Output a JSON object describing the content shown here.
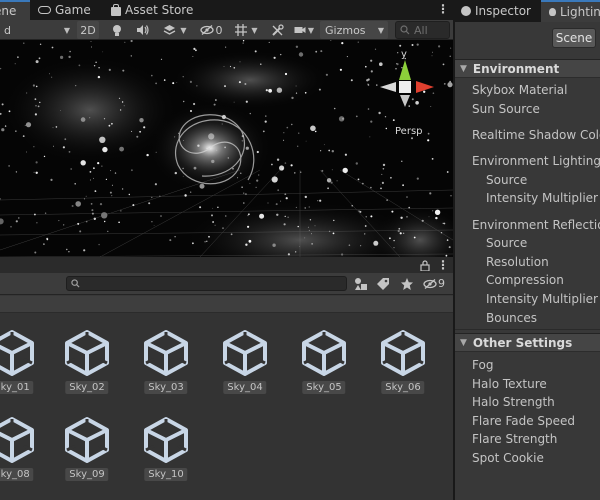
{
  "scene_tabs": {
    "scene_label": "ene",
    "game_label": "Game",
    "asset_store_label": "Asset Store"
  },
  "scene_toolbar": {
    "shading_value": "d",
    "mode_2d": "2D",
    "hidden_count": "0",
    "gizmos_label": "Gizmos",
    "search_placeholder": "All"
  },
  "viewport": {
    "projection_label": "Persp",
    "axis_y_label": "y"
  },
  "project": {
    "hidden_count": "9",
    "assets": [
      {
        "name": "Sky_01"
      },
      {
        "name": "Sky_02"
      },
      {
        "name": "Sky_03"
      },
      {
        "name": "Sky_04"
      },
      {
        "name": "Sky_05"
      },
      {
        "name": "Sky_06"
      },
      {
        "name": "Sky_08"
      },
      {
        "name": "Sky_09"
      },
      {
        "name": "Sky_10"
      }
    ]
  },
  "right_tabs": {
    "inspector_label": "Inspector",
    "lighting_label": "Lighting"
  },
  "lighting": {
    "scene_button": "Scene",
    "environment": {
      "title": "Environment",
      "skybox_material": "Skybox Material",
      "sun_source": "Sun Source",
      "realtime_shadow_color": "Realtime Shadow Color",
      "environment_lighting": "Environment Lighting",
      "lighting_source": "Source",
      "lighting_intensity_multiplier": "Intensity Multiplier",
      "environment_reflections": "Environment Reflections",
      "reflections_source": "Source",
      "resolution": "Resolution",
      "compression": "Compression",
      "reflections_intensity_multiplier": "Intensity Multiplier",
      "bounces": "Bounces"
    },
    "other_settings": {
      "title": "Other Settings",
      "fog": "Fog",
      "halo_texture": "Halo Texture",
      "halo_strength": "Halo Strength",
      "flare_fade_speed": "Flare Fade Speed",
      "flare_strength": "Flare Strength",
      "spot_cookie": "Spot Cookie"
    }
  },
  "colors": {
    "tab_accent": "#3a79bb",
    "gizmo_y": "#8cd03a",
    "gizmo_x": "#e0402f",
    "unity_icon": "#c8d6e6"
  }
}
